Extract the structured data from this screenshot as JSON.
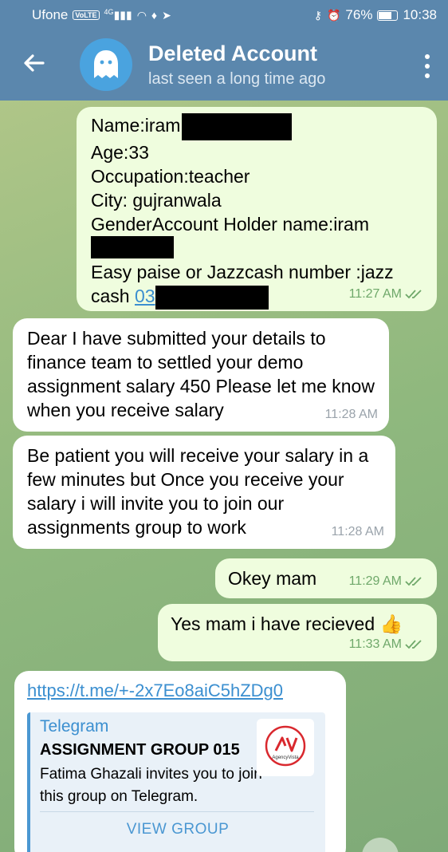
{
  "status_bar": {
    "carrier": "Ufone",
    "volte": "VoLTE",
    "network": "4G",
    "battery_percent": "76%",
    "battery_level": 0.76,
    "time": "10:38"
  },
  "header": {
    "title": "Deleted Account",
    "subtitle": "last seen a long time ago"
  },
  "messages": [
    {
      "direction": "outgoing",
      "lines": [
        "Name:iram",
        "Age:33",
        "Occupation:teacher",
        "City: gujranwala",
        "GenderAccount Holder name:iram",
        "",
        "Easy paise or Jazzcash number :jazz",
        "cash"
      ],
      "link_fragment": "03",
      "time": "11:27 AM"
    },
    {
      "direction": "incoming",
      "text": "Dear I have submitted your details to finance team to settled your demo assignment salary 450 Please let me know when you receive salary",
      "time": "11:28 AM"
    },
    {
      "direction": "incoming",
      "text": "Be patient you will receive your salary in a few minutes but Once you receive your salary i will  invite you to join our assignments group to work",
      "time": "11:28 AM"
    },
    {
      "direction": "outgoing",
      "text": "Okey mam",
      "time": "11:29 AM"
    },
    {
      "direction": "outgoing",
      "text": "Yes mam i have recieved",
      "emoji": "👍",
      "time": "11:33 AM"
    }
  ],
  "link_preview": {
    "url": "https://t.me/+-2x7Eo8aiC5hZDg0",
    "site": "Telegram",
    "title": "ASSIGNMENT GROUP 015",
    "description": "Fatima Ghazali invites you to join this group on Telegram.",
    "button": "VIEW GROUP",
    "thumb_text": "AgencyVista"
  },
  "colors": {
    "header": "#5b87ad",
    "outgoing_bubble": "#effdde",
    "incoming_bubble": "#ffffff",
    "link": "#3b8fd0",
    "tick": "#6fa86a"
  }
}
